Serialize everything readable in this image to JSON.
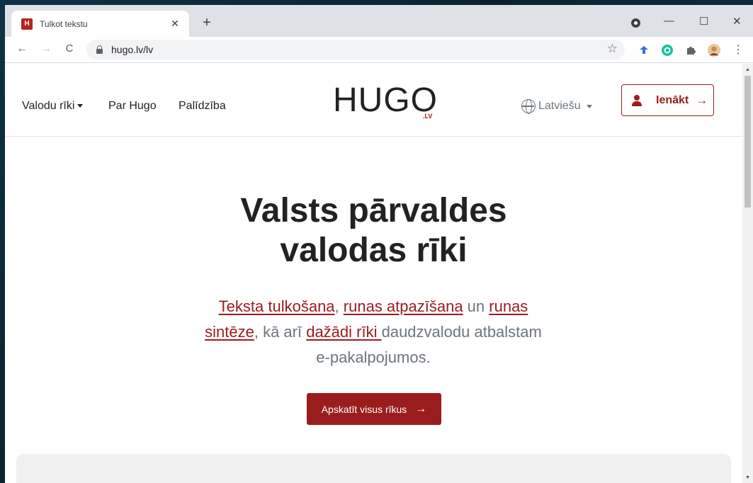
{
  "browser": {
    "tab_title": "Tulkot tekstu",
    "favicon_letter": "H",
    "new_tab": "+",
    "tab_close": "✕",
    "window_min": "—",
    "window_max": "☐",
    "window_close": "✕",
    "url": "hugo.lv/lv",
    "back": "←",
    "forward": "→",
    "reload": "C",
    "bookmark": "☆",
    "menu": "⋮"
  },
  "nav": {
    "tools": "Valodu rīki",
    "about": "Par Hugo",
    "help": "Palīdzība",
    "logo": "HUGO",
    "logo_suffix": ".LV",
    "language": "Latviešu",
    "login": "Ienākt",
    "login_arrow": "→"
  },
  "hero": {
    "title_line1": "Valsts pārvaldes",
    "title_line2": "valodas rīki",
    "link1": "Teksta tulkošana",
    "sep1": ", ",
    "link2": "runas atpazīšana",
    "t1": " un ",
    "link3": "runas sintēze",
    "t2": ", kā arī ",
    "link4": "dažādi rīki ",
    "t3": "daudzvalodu atbalstam e-pakalpojumos.",
    "cta": "Apskatīt visus rīkus",
    "cta_arrow": "→"
  },
  "colors": {
    "brand": "#9b1c1c",
    "text_muted": "#6c757d"
  }
}
